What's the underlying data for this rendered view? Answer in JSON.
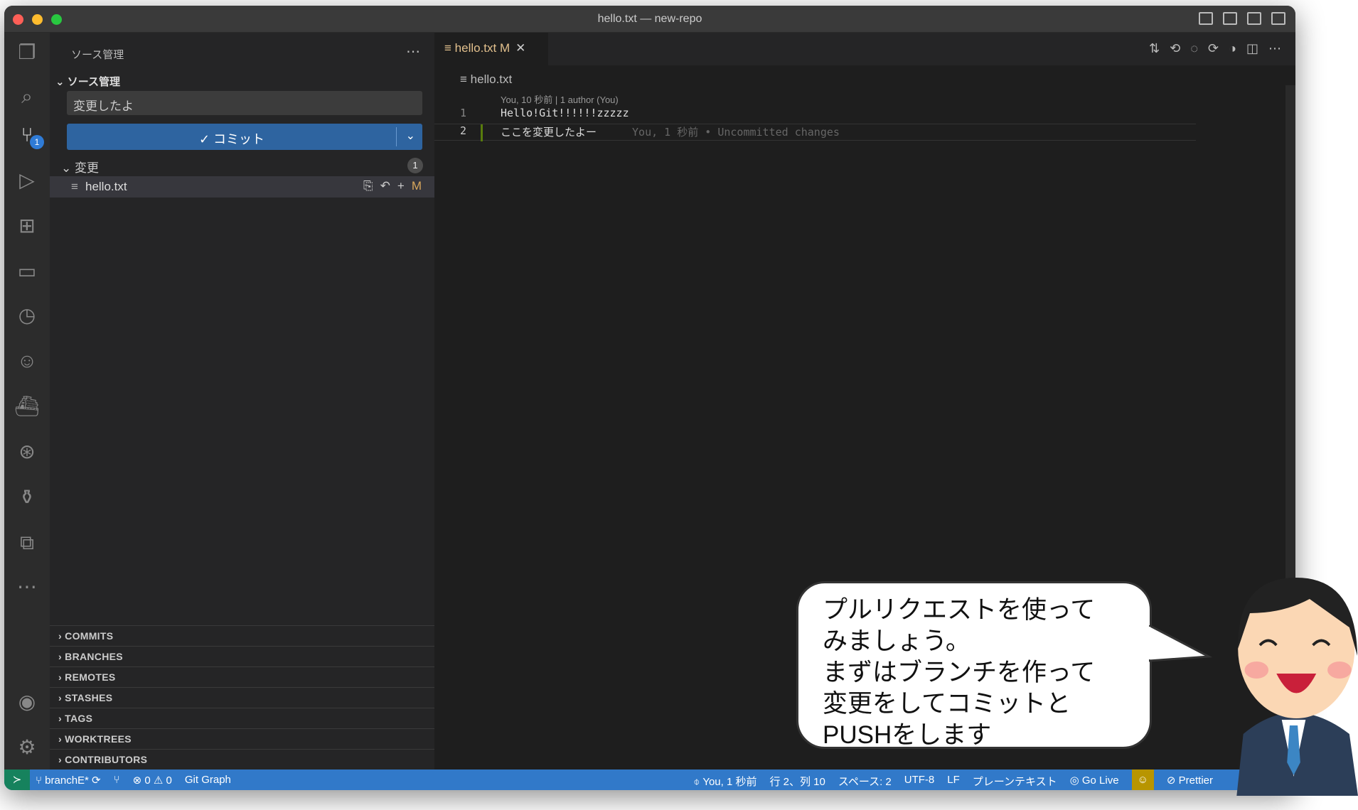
{
  "window": {
    "title": "hello.txt — new-repo"
  },
  "sidebar": {
    "header": "ソース管理",
    "section": "ソース管理",
    "commit_message": "変更したよ",
    "commit_button": "✓ コミット",
    "changes_label": "変更",
    "changes_count": "1",
    "file": {
      "name": "hello.txt",
      "status": "M"
    },
    "panels": [
      "COMMITS",
      "BRANCHES",
      "REMOTES",
      "STASHES",
      "TAGS",
      "WORKTREES",
      "CONTRIBUTORS"
    ]
  },
  "activity": {
    "scm_badge": "1"
  },
  "editor": {
    "tab": {
      "name": "hello.txt",
      "status": "M"
    },
    "breadcrumb": "hello.txt",
    "codelens": "You, 10 秒前 | 1 author (You)",
    "lines": [
      {
        "n": "1",
        "text": "Hello!Git!!!!!!zzzzz",
        "blame": ""
      },
      {
        "n": "2",
        "text": "ここを変更したよー",
        "blame": "You, 1 秒前 • Uncommitted changes"
      }
    ]
  },
  "status": {
    "branch": "branchE*",
    "problems": "⊗ 0 ⚠ 0",
    "git_graph": "Git Graph",
    "blame": "You, 1 秒前",
    "position": "行 2、列 10",
    "spaces": "スペース: 2",
    "encoding": "UTF-8",
    "eol": "LF",
    "language": "プレーンテキスト",
    "golive": "Go Live",
    "prettier": "Prettier"
  },
  "bubble": {
    "lines": [
      "プルリクエストを使って",
      "みましょう。",
      "まずはブランチを作って",
      "変更をしてコミットと",
      "PUSHをします"
    ]
  }
}
